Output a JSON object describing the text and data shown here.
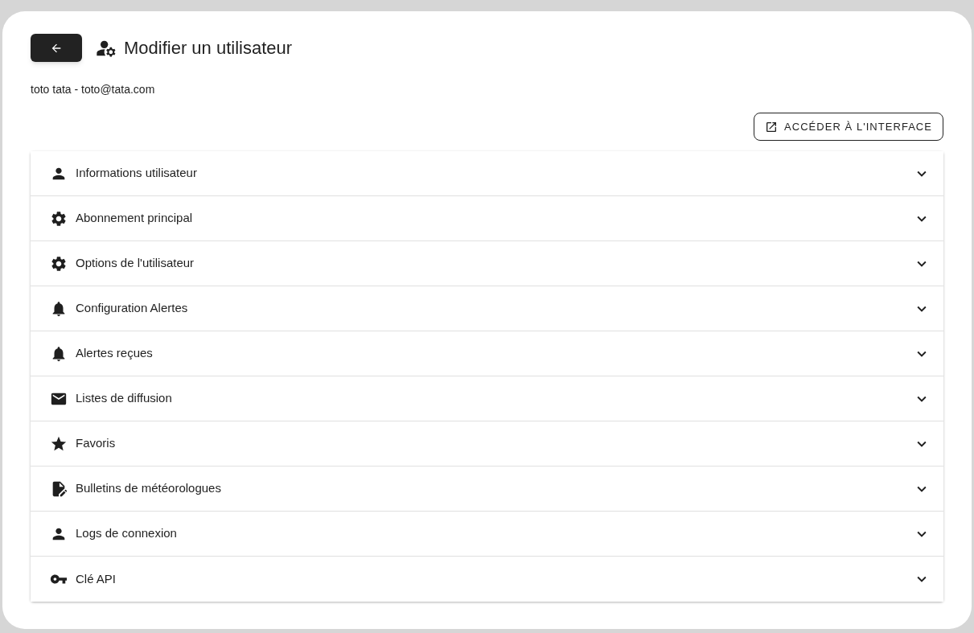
{
  "header": {
    "title": "Modifier un utilisateur"
  },
  "user_summary": "toto tata - toto@tata.com",
  "interface_button": {
    "label": "ACCÉDER À L'INTERFACE"
  },
  "sections": [
    {
      "kind": "person",
      "label": "Informations utilisateur",
      "expanded": false
    },
    {
      "kind": "gear",
      "label": "Abonnement principal",
      "expanded": false
    },
    {
      "kind": "gear",
      "label": "Options de l'utilisateur",
      "expanded": false
    },
    {
      "kind": "bell",
      "label": "Configuration Alertes",
      "expanded": false
    },
    {
      "kind": "bell",
      "label": "Alertes reçues",
      "expanded": false
    },
    {
      "kind": "mail",
      "label": "Listes de diffusion",
      "expanded": false
    },
    {
      "kind": "star",
      "label": "Favoris",
      "expanded": false
    },
    {
      "kind": "document",
      "label": "Bulletins de météorologues",
      "expanded": false
    },
    {
      "kind": "person",
      "label": "Logs de connexion",
      "expanded": false
    },
    {
      "kind": "key",
      "label": "Clé API",
      "expanded": false
    }
  ]
}
